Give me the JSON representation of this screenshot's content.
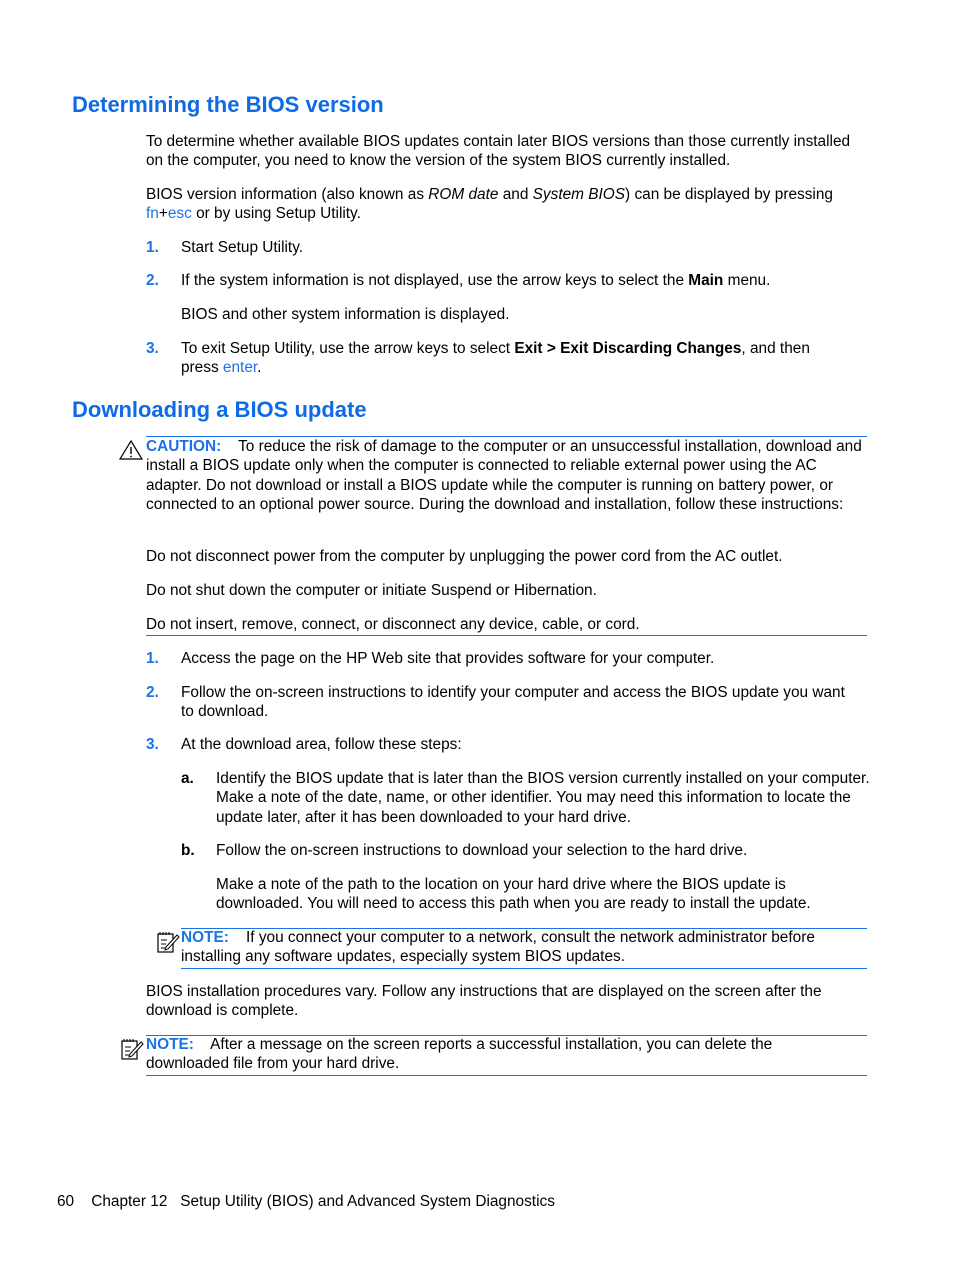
{
  "section1": {
    "heading": "Determining the BIOS version",
    "para1": "To determine whether available BIOS updates contain later BIOS versions than those currently installed on the computer, you need to know the version of the system BIOS currently installed.",
    "para2": {
      "t1": "BIOS version information (also known as ",
      "i1": "ROM date",
      "t2": " and ",
      "i2": "System BIOS",
      "t3": ") can be displayed by pressing",
      "key1": "fn",
      "plus": "+",
      "key2": "esc",
      "t4": " or by using Setup Utility."
    },
    "steps": [
      {
        "num": "1.",
        "text": "Start Setup Utility."
      },
      {
        "num": "2.",
        "t1": "If the system information is not displayed, use the arrow keys to select the ",
        "b1": "Main",
        "t2": " menu.",
        "sub": "BIOS and other system information is displayed."
      },
      {
        "num": "3.",
        "t1": "To exit Setup Utility, use the arrow keys to select ",
        "b1": "Exit > Exit Discarding Changes",
        "t2": ", and then",
        "t3": "press ",
        "key": "enter",
        "t4": "."
      }
    ]
  },
  "section2": {
    "heading": "Downloading a BIOS update",
    "caution": {
      "label": "CAUTION:",
      "text": "To reduce the risk of damage to the computer or an unsuccessful installation, download and install a BIOS update only when the computer is connected to reliable external power using the AC adapter. Do not download or install a BIOS update while the computer is running on battery power, or connected to an optional power source. During the download and installation, follow these instructions:",
      "lines": [
        "Do not disconnect power from the computer by unplugging the power cord from the AC outlet.",
        "Do not shut down the computer or initiate Suspend or Hibernation.",
        "Do not insert, remove, connect, or disconnect any device, cable, or cord."
      ]
    },
    "steps": [
      {
        "num": "1.",
        "text": "Access the page on the HP Web site that provides software for your computer."
      },
      {
        "num": "2.",
        "text": "Follow the on-screen instructions to identify your computer and access the BIOS update you want to download."
      },
      {
        "num": "3.",
        "text": "At the download area, follow these steps:"
      }
    ],
    "substeps": [
      {
        "label": "a.",
        "text": "Identify the BIOS update that is later than the BIOS version currently installed on your computer. Make a note of the date, name, or other identifier. You may need this information to locate the update later, after it has been downloaded to your hard drive."
      },
      {
        "label": "b.",
        "text": "Follow the on-screen instructions to download your selection to the hard drive.",
        "sub": "Make a note of the path to the location on your hard drive where the BIOS update is downloaded. You will need to access this path when you are ready to install the update."
      }
    ],
    "note1": {
      "label": "NOTE:",
      "text": "If you connect your computer to a network, consult the network administrator before installing any software updates, especially system BIOS updates."
    },
    "para_after": "BIOS installation procedures vary. Follow any instructions that are displayed on the screen after the download is complete.",
    "note2": {
      "label": "NOTE:",
      "text": "After a message on the screen reports a successful installation, you can delete the downloaded file from your hard drive."
    }
  },
  "footer": {
    "page_number": "60",
    "chapter": "Chapter 12",
    "title": "Setup Utility (BIOS) and Advanced System Diagnostics"
  }
}
